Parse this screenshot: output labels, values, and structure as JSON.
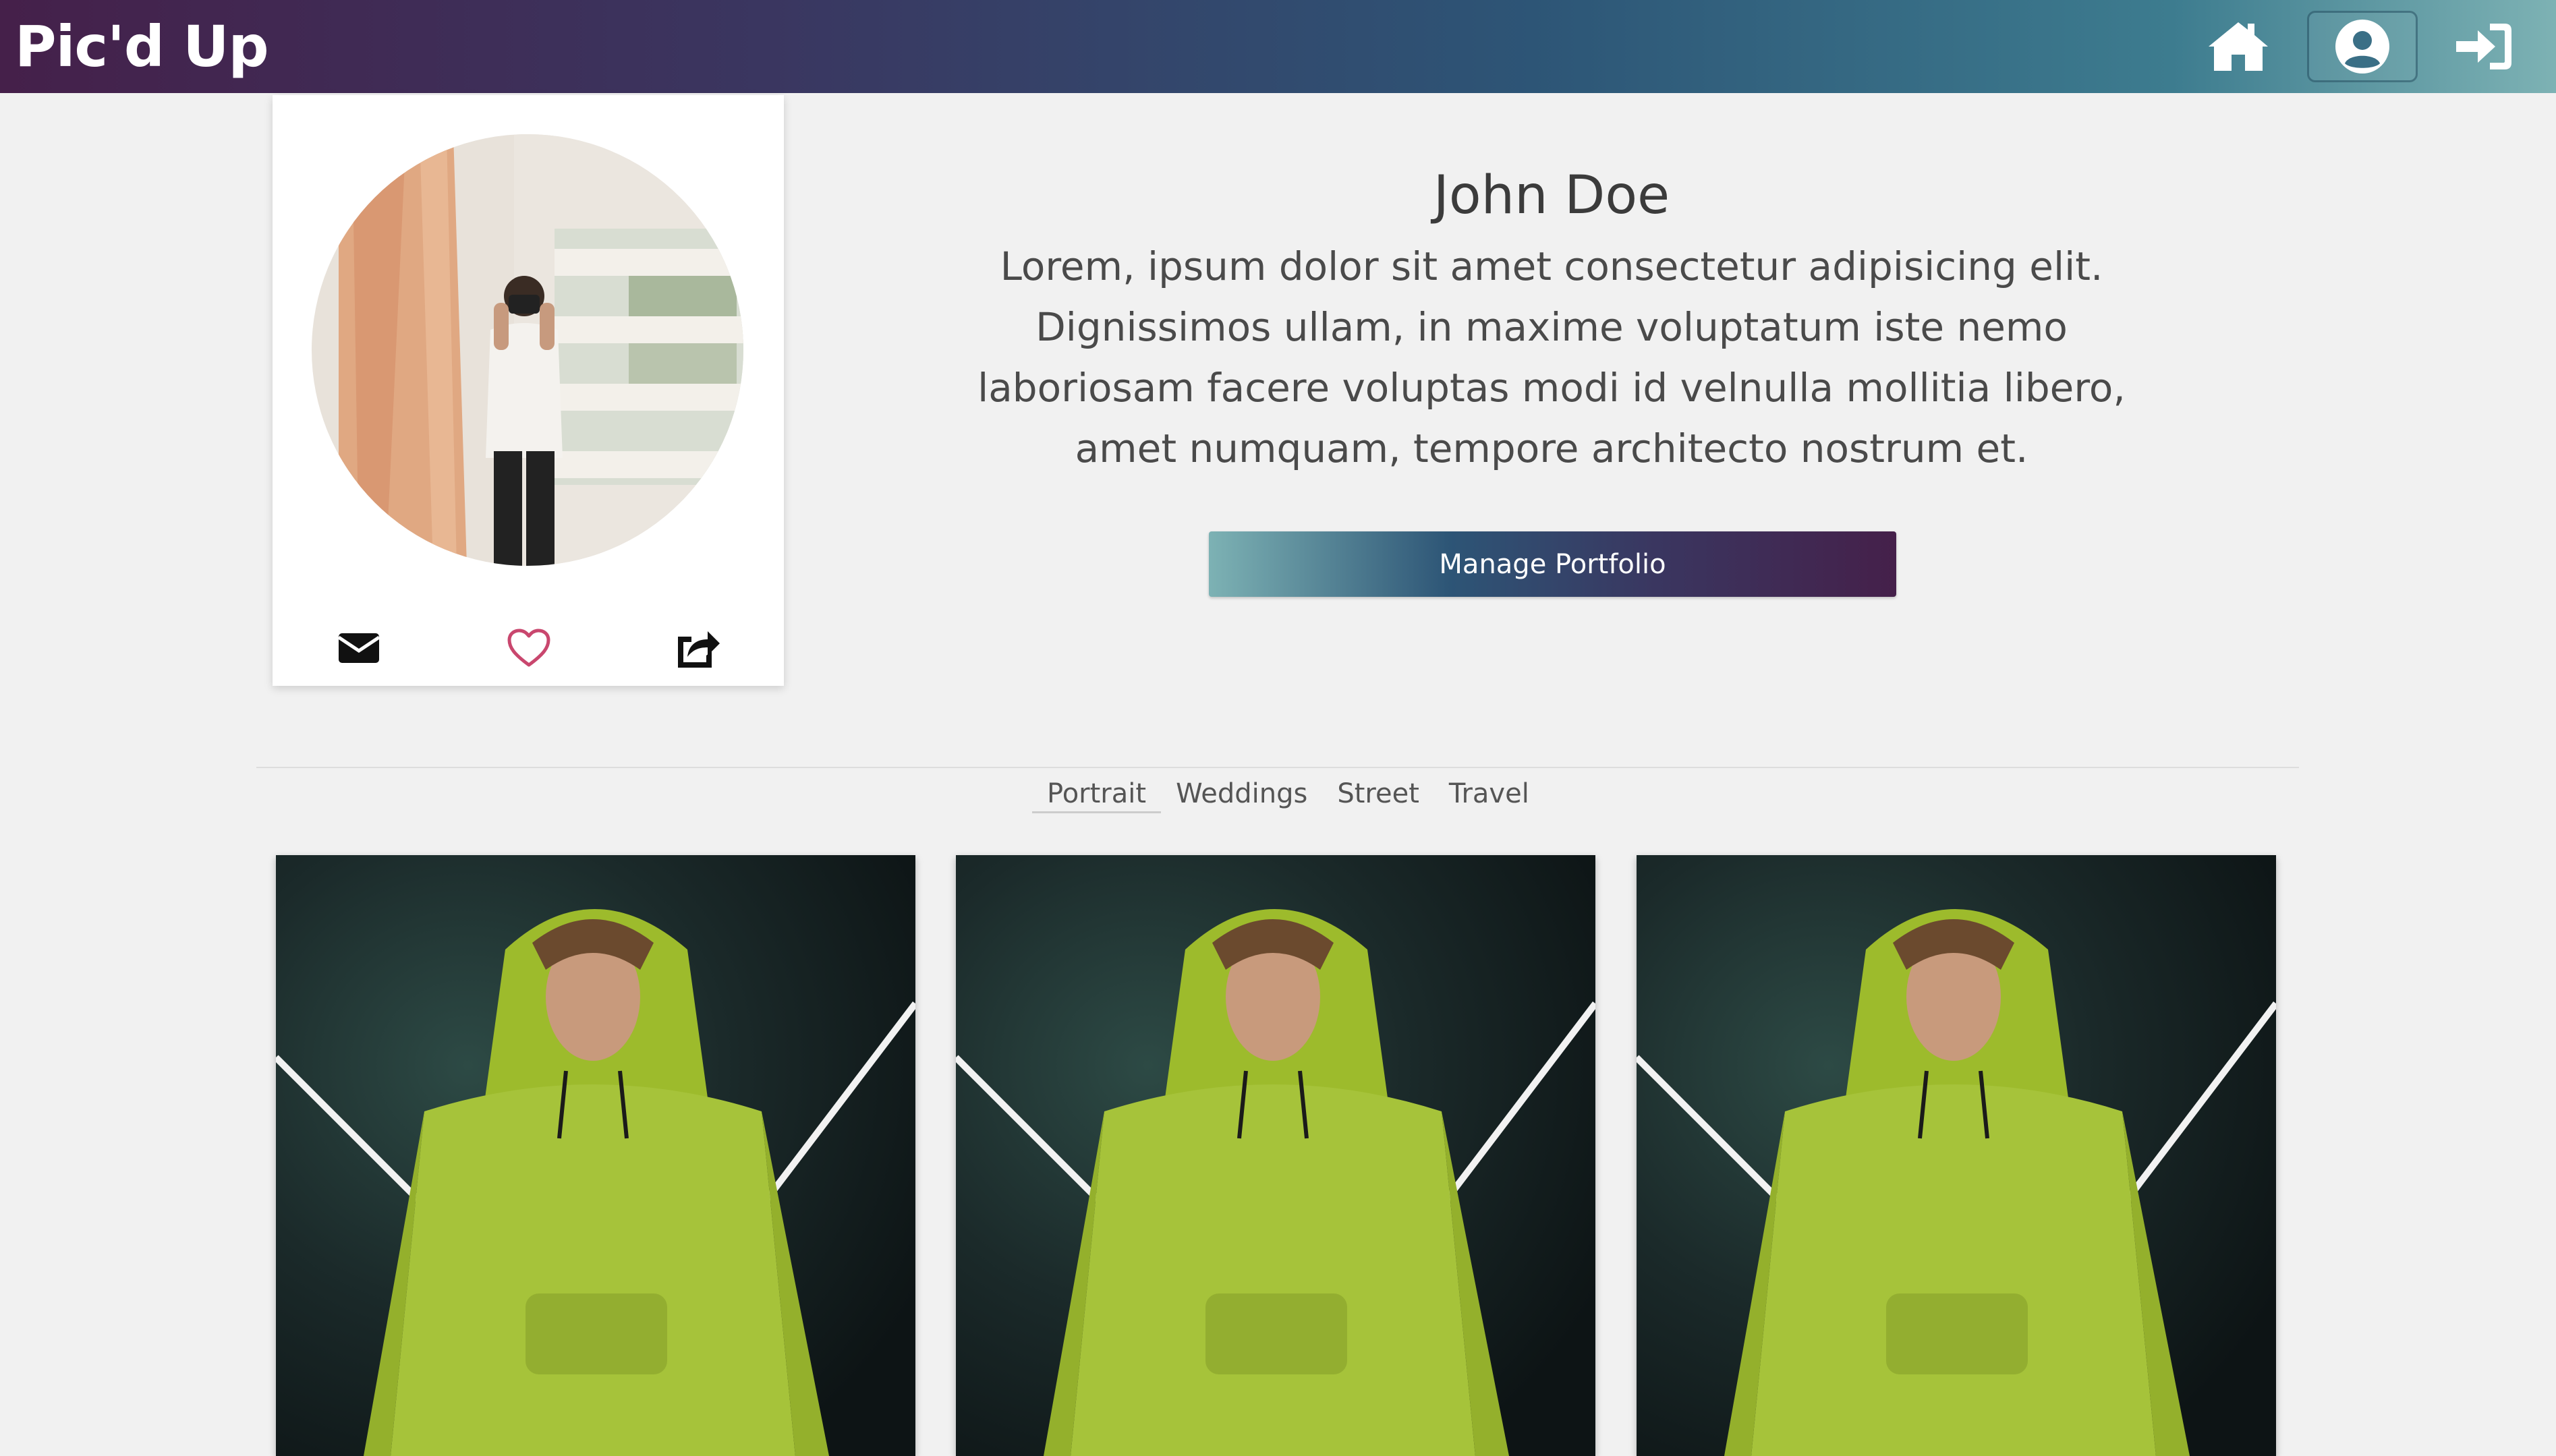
{
  "navbar": {
    "brand": "Pic'd Up",
    "icons": [
      "home-icon",
      "user-circle-icon",
      "sign-in-icon"
    ]
  },
  "profile": {
    "name": "John Doe",
    "bio": "Lorem, ipsum dolor sit amet consectetur adipisicing elit. Dignissimos ullam, in maxime voluptatum iste nemo laboriosam facere voluptas modi id velnulla mollitia libero, amet numquam, tempore architecto nostrum et.",
    "manage_button": "Manage Portfolio",
    "card_icons": [
      "envelope-icon",
      "heart-icon",
      "share-icon"
    ]
  },
  "tabs": [
    {
      "label": "Portrait",
      "active": true
    },
    {
      "label": "Weddings",
      "active": false
    },
    {
      "label": "Street",
      "active": false
    },
    {
      "label": "Travel",
      "active": false
    }
  ],
  "colors": {
    "gradient_purple": "#45204a",
    "gradient_blue": "#2d5576",
    "gradient_teal": "#7db2b4",
    "heart": "#c9476e",
    "background": "#f1f1f1"
  }
}
